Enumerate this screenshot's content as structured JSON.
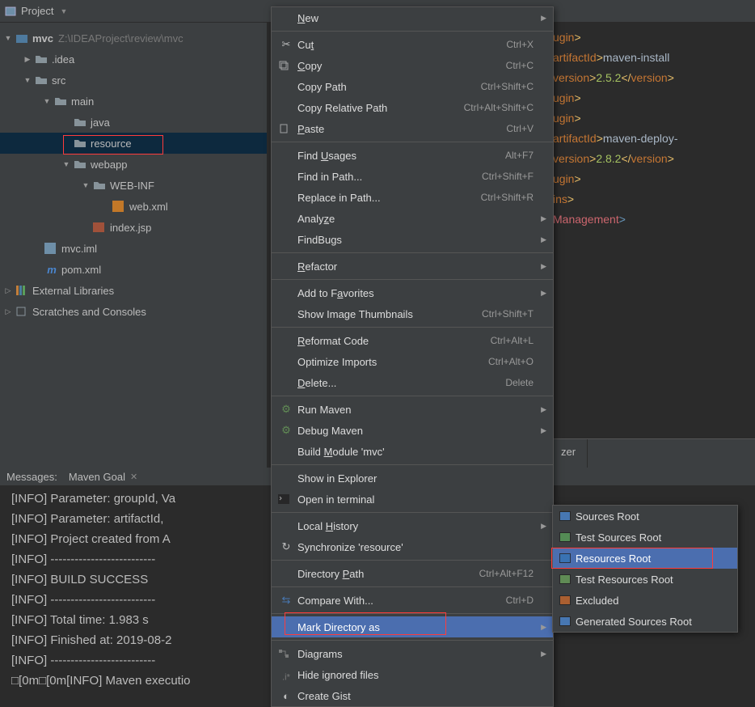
{
  "toolbar": {
    "title": "Project"
  },
  "tree": {
    "root": {
      "name": "mvc",
      "path": "Z:\\IDEAProject\\review\\mvc"
    },
    "nodes": {
      "idea": ".idea",
      "src": "src",
      "main": "main",
      "java": "java",
      "resource": "resource",
      "webapp": "webapp",
      "webinf": "WEB-INF",
      "webxml": "web.xml",
      "indexjsp": "index.jsp",
      "mvciml": "mvc.iml",
      "pomxml": "pom.xml",
      "extlib": "External Libraries",
      "scratch": "Scratches and Consoles"
    }
  },
  "editor_lines": [
    {
      "segments": [
        {
          "t": "ugin",
          "c": "name"
        },
        {
          "t": ">",
          "c": "tag"
        }
      ]
    },
    {
      "segments": [
        {
          "t": "artifactId",
          "c": "name"
        },
        {
          "t": ">",
          "c": "tag"
        },
        {
          "t": "maven-install",
          "c": "text"
        }
      ]
    },
    {
      "segments": [
        {
          "t": "version",
          "c": "name"
        },
        {
          "t": ">",
          "c": "tag"
        },
        {
          "t": "2.5.2",
          "c": "green"
        },
        {
          "t": "</",
          "c": "tag"
        },
        {
          "t": "version",
          "c": "name"
        },
        {
          "t": ">",
          "c": "tag"
        }
      ]
    },
    {
      "segments": [
        {
          "t": "ugin",
          "c": "name"
        },
        {
          "t": ">",
          "c": "tag"
        }
      ]
    },
    {
      "segments": [
        {
          "t": "ugin",
          "c": "name"
        },
        {
          "t": ">",
          "c": "tag"
        }
      ]
    },
    {
      "segments": [
        {
          "t": "artifactId",
          "c": "name"
        },
        {
          "t": ">",
          "c": "tag"
        },
        {
          "t": "maven-deploy-",
          "c": "text"
        }
      ]
    },
    {
      "segments": [
        {
          "t": "version",
          "c": "name"
        },
        {
          "t": ">",
          "c": "tag"
        },
        {
          "t": "2.8.2",
          "c": "green"
        },
        {
          "t": "</",
          "c": "tag"
        },
        {
          "t": "version",
          "c": "name"
        },
        {
          "t": ">",
          "c": "tag"
        }
      ]
    },
    {
      "segments": [
        {
          "t": "ugin",
          "c": "name"
        },
        {
          "t": ">",
          "c": "tag"
        }
      ]
    },
    {
      "segments": [
        {
          "t": "ins",
          "c": "name"
        },
        {
          "t": ">",
          "c": "tag"
        }
      ]
    },
    {
      "segments": [
        {
          "t": "Management",
          "c": "red"
        },
        {
          "t": ">",
          "c": "sep"
        }
      ]
    }
  ],
  "tabs_bottom_editor": [
    "zer"
  ],
  "messages": {
    "label": "Messages:",
    "tab": "Maven Goal"
  },
  "console_lines": [
    "[INFO] Parameter: groupId, Va",
    "[INFO] Parameter: artifactId,",
    "[INFO] Project created from A",
    "[INFO] --------------------------",
    "[INFO] BUILD SUCCESS",
    "[INFO] --------------------------",
    "[INFO] Total time: 1.983 s",
    "[INFO] Finished at: 2019-08-2",
    "[INFO] --------------------------",
    "□[0m□[0m[INFO] Maven executio"
  ],
  "context": {
    "new": "New",
    "cut": "Cut",
    "cut_sc": "Ctrl+X",
    "copy": "Copy",
    "copy_sc": "Ctrl+C",
    "copypath": "Copy Path",
    "copypath_sc": "Ctrl+Shift+C",
    "copyrel": "Copy Relative Path",
    "copyrel_sc": "Ctrl+Alt+Shift+C",
    "paste": "Paste",
    "paste_sc": "Ctrl+V",
    "findusages": "Find Usages",
    "findusages_sc": "Alt+F7",
    "findinpath": "Find in Path...",
    "findinpath_sc": "Ctrl+Shift+F",
    "replaceinpath": "Replace in Path...",
    "replaceinpath_sc": "Ctrl+Shift+R",
    "analyze": "Analyze",
    "findbugs": "FindBugs",
    "refactor": "Refactor",
    "addfav": "Add to Favorites",
    "showthumb": "Show Image Thumbnails",
    "showthumb_sc": "Ctrl+Shift+T",
    "reformat": "Reformat Code",
    "reformat_sc": "Ctrl+Alt+L",
    "optimize": "Optimize Imports",
    "optimize_sc": "Ctrl+Alt+O",
    "delete": "Delete...",
    "delete_sc": "Delete",
    "runmaven": "Run Maven",
    "debugmaven": "Debug Maven",
    "buildmodule": "Build Module 'mvc'",
    "showexplorer": "Show in Explorer",
    "openterm": "Open in terminal",
    "localhist": "Local History",
    "syncres": "Synchronize 'resource'",
    "dirpath": "Directory Path",
    "dirpath_sc": "Ctrl+Alt+F12",
    "compare": "Compare With...",
    "compare_sc": "Ctrl+D",
    "markdir": "Mark Directory as",
    "diagrams": "Diagrams",
    "hideignored": "Hide ignored files",
    "creategist": "Create Gist"
  },
  "submenu": {
    "sources": "Sources Root",
    "testsources": "Test Sources Root",
    "resources": "Resources Root",
    "testresources": "Test Resources Root",
    "excluded": "Excluded",
    "generated": "Generated Sources Root"
  }
}
